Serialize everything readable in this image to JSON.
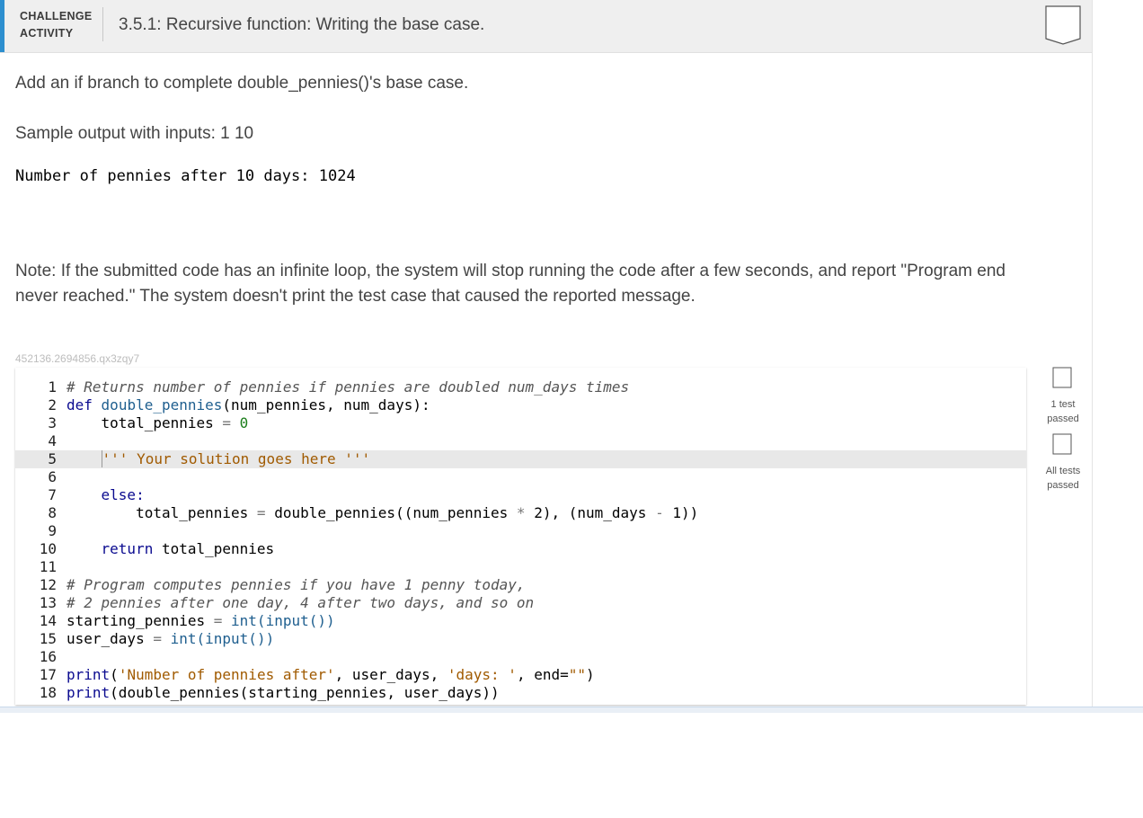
{
  "header": {
    "label_line1": "CHALLENGE",
    "label_line2": "ACTIVITY",
    "title": "3.5.1: Recursive function: Writing the base case."
  },
  "prompt": "Add an if branch to complete double_pennies()'s base case.",
  "sample_label": "Sample output with inputs: 1 10",
  "sample_output": "Number of pennies after 10 days: 1024",
  "note": "Note: If the submitted code has an infinite loop, the system will stop running the code after a few seconds, and report \"Program end never reached.\" The system doesn't print the test case that caused the reported message.",
  "activity_id": "452136.2694856.qx3zqy7",
  "status": {
    "test1_line1": "1 test",
    "test1_line2": "passed",
    "all_line1": "All tests",
    "all_line2": "passed"
  },
  "code": {
    "line_numbers": [
      "1",
      "2",
      "3",
      "4",
      "5",
      "6",
      "7",
      "8",
      "9",
      "10",
      "11",
      "12",
      "13",
      "14",
      "15",
      "16",
      "17",
      "18"
    ],
    "l1": "# Returns number of pennies if pennies are doubled num_days times",
    "l2_kw": "def",
    "l2_name": "double_pennies",
    "l2_args": "(num_pennies, num_days):",
    "l3_var": "total_pennies",
    "l3_op": " = ",
    "l3_num": "0",
    "l5": "''' Your solution goes here '''",
    "l7": "else:",
    "l8_a": "total_pennies",
    "l8_b": " = ",
    "l8_c": "double_pennies((num_pennies ",
    "l8_d": "*",
    "l8_e": " 2), (num_days ",
    "l8_f": "-",
    "l8_g": " 1))",
    "l10_kw": "return",
    "l10_var": " total_pennies",
    "l12": "# Program computes pennies if you have 1 penny today,",
    "l13": "# 2 pennies after one day, 4 after two days, and so on",
    "l14_a": "starting_pennies",
    "l14_b": " = ",
    "l14_c": "int(input())",
    "l15_a": "user_days",
    "l15_b": " = ",
    "l15_c": "int(input())",
    "l17_kw": "print",
    "l17_a": "(",
    "l17_s1": "'Number of pennies after'",
    "l17_b": ", user_days, ",
    "l17_s2": "'days: '",
    "l17_c": ", end=",
    "l17_s3": "\"\"",
    "l17_d": ")",
    "l18_kw": "print",
    "l18_a": "(double_pennies(starting_pennies, user_days))"
  }
}
